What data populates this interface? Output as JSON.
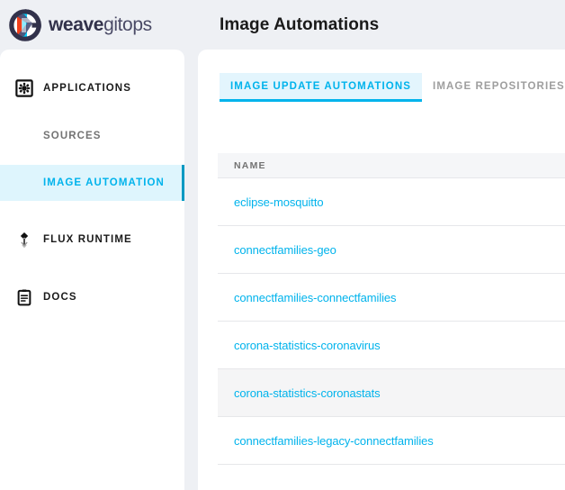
{
  "brand": {
    "logo_icon": "weavegitops-circle-logo",
    "name_bold": "weave",
    "name_light": "gitops"
  },
  "header": {
    "title": "Image Automations"
  },
  "sidebar": {
    "items": [
      {
        "id": "applications",
        "label": "APPLICATIONS",
        "icon": "applications-gear-icon",
        "type": "top",
        "selected": false
      },
      {
        "id": "sources",
        "label": "SOURCES",
        "icon": null,
        "type": "sub",
        "selected": false
      },
      {
        "id": "image-automation",
        "label": "IMAGE AUTOMATION",
        "icon": null,
        "type": "sub",
        "selected": true
      },
      {
        "id": "flux-runtime",
        "label": "FLUX RUNTIME",
        "icon": "flux-diamond-icon",
        "type": "top",
        "selected": false
      },
      {
        "id": "docs",
        "label": "DOCS",
        "icon": "docs-clipboard-icon",
        "type": "top",
        "selected": false
      }
    ]
  },
  "main": {
    "tabs": [
      {
        "id": "image-update-automations",
        "label": "IMAGE UPDATE AUTOMATIONS",
        "active": true
      },
      {
        "id": "image-repositories",
        "label": "IMAGE REPOSITORIES",
        "active": false
      }
    ],
    "table": {
      "columns": [
        "NAME"
      ],
      "rows": [
        {
          "name": "eclipse-mosquitto",
          "highlight": false
        },
        {
          "name": "connectfamilies-geo",
          "highlight": false
        },
        {
          "name": "connectfamilies-connectfamilies",
          "highlight": false
        },
        {
          "name": "corona-statistics-coronavirus",
          "highlight": false
        },
        {
          "name": "corona-statistics-coronastats",
          "highlight": true
        },
        {
          "name": "connectfamilies-legacy-connectfamilies",
          "highlight": false
        }
      ]
    }
  },
  "colors": {
    "accent_blue": "#00b3ec",
    "accent_border": "#0099c2",
    "tab_active_bg": "#e3f5fd",
    "sidebar_selected_bg": "#def5fd",
    "page_bg": "#eef0f4",
    "panel_bg": "#ffffff",
    "table_header_bg": "#f5f6f8",
    "row_highlight_bg": "#f5f5f6",
    "text_dark": "#1a1a1a",
    "text_muted": "#737373",
    "logo_navy": "#32324b"
  }
}
